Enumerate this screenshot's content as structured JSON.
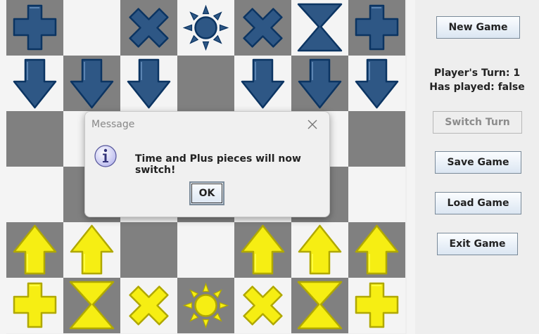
{
  "board": {
    "rows": [
      [
        "blue-plus",
        "empty",
        "blue-cross",
        "blue-sun",
        "blue-cross",
        "blue-hourglass",
        "blue-plus"
      ],
      [
        "blue-arrow-down",
        "blue-arrow-down",
        "blue-arrow-down",
        "empty",
        "blue-arrow-down",
        "blue-arrow-down",
        "blue-arrow-down"
      ],
      [
        "empty",
        "empty",
        "empty",
        "empty",
        "empty",
        "empty",
        "empty"
      ],
      [
        "empty",
        "empty",
        "empty",
        "empty",
        "empty",
        "empty",
        "empty"
      ],
      [
        "yellow-arrow-up",
        "yellow-arrow-up",
        "empty",
        "empty",
        "yellow-arrow-up",
        "yellow-arrow-up",
        "yellow-arrow-up"
      ],
      [
        "yellow-plus",
        "yellow-hourglass",
        "yellow-cross",
        "yellow-sun",
        "yellow-cross",
        "yellow-hourglass",
        "yellow-plus"
      ]
    ],
    "colors": {
      "light": "#f4f4f4",
      "dark": "#808080",
      "blue": "#2e5785",
      "yellow": "#f6ee13"
    }
  },
  "panel": {
    "new_game": "New Game",
    "players_turn": "Player's Turn: 1",
    "has_played": "Has played: false",
    "switch_turn": "Switch Turn",
    "save_game": "Save Game",
    "load_game": "Load Game",
    "exit_game": "Exit Game"
  },
  "dialog": {
    "title": "Message",
    "message": "Time and Plus pieces will now switch!",
    "ok": "OK",
    "icon": "info-icon"
  }
}
